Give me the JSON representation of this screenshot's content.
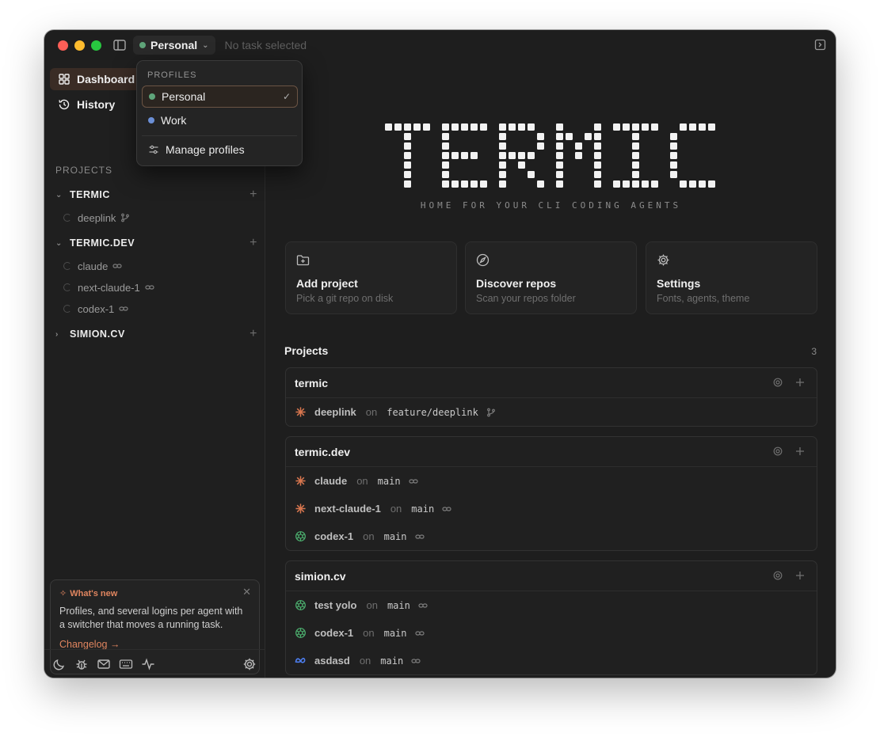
{
  "titlebar": {
    "profile_name": "Personal",
    "profile_color": "#5fa57a",
    "task_status": "No task selected"
  },
  "sidebar": {
    "nav": [
      {
        "label": "Dashboard",
        "icon": "grid-icon",
        "active": true
      },
      {
        "label": "History",
        "icon": "history-icon",
        "active": false
      }
    ],
    "projects_label": "PROJECTS",
    "projects": [
      {
        "name": "TERMIC",
        "expanded": true,
        "tasks": [
          {
            "name": "deeplink",
            "icon": "branch-icon"
          }
        ]
      },
      {
        "name": "TERMIC.DEV",
        "expanded": true,
        "tasks": [
          {
            "name": "claude",
            "icon": "link-icon"
          },
          {
            "name": "next-claude-1",
            "icon": "link-icon"
          },
          {
            "name": "codex-1",
            "icon": "link-icon"
          }
        ]
      },
      {
        "name": "SIMION.CV",
        "expanded": false,
        "tasks": []
      }
    ],
    "whats_new": {
      "title": "What's new",
      "body": "Profiles, and several logins per agent with a switcher that moves a running task.",
      "link": "Changelog →"
    }
  },
  "main": {
    "logo_text": "TERMIC",
    "tagline": "HOME FOR YOUR CLI CODING AGENTS",
    "cards": [
      {
        "title": "Add project",
        "subtitle": "Pick a git repo on disk",
        "icon": "folder-plus-icon"
      },
      {
        "title": "Discover repos",
        "subtitle": "Scan your repos folder",
        "icon": "compass-icon"
      },
      {
        "title": "Settings",
        "subtitle": "Fonts, agents, theme",
        "icon": "gear-icon"
      }
    ],
    "projects_heading": "Projects",
    "projects_count": "3",
    "project_cards": [
      {
        "name": "termic",
        "rows": [
          {
            "agent": "claude",
            "name": "deeplink",
            "on": "on",
            "branch": "feature/deeplink",
            "tail": "branch-icon"
          }
        ]
      },
      {
        "name": "termic.dev",
        "rows": [
          {
            "agent": "claude",
            "name": "claude",
            "on": "on",
            "branch": "main",
            "tail": "link-icon"
          },
          {
            "agent": "claude",
            "name": "next-claude-1",
            "on": "on",
            "branch": "main",
            "tail": "link-icon"
          },
          {
            "agent": "codex",
            "name": "codex-1",
            "on": "on",
            "branch": "main",
            "tail": "link-icon"
          }
        ]
      },
      {
        "name": "simion.cv",
        "rows": [
          {
            "agent": "codex",
            "name": "test yolo",
            "on": "on",
            "branch": "main",
            "tail": "link-icon"
          },
          {
            "agent": "codex",
            "name": "codex-1",
            "on": "on",
            "branch": "main",
            "tail": "link-icon"
          },
          {
            "agent": "meta",
            "name": "asdasd",
            "on": "on",
            "branch": "main",
            "tail": "link-icon"
          }
        ]
      }
    ]
  },
  "profiles_menu": {
    "label": "PROFILES",
    "items": [
      {
        "name": "Personal",
        "color": "#5fa57a",
        "selected": true
      },
      {
        "name": "Work",
        "color": "#6b8fd6",
        "selected": false
      }
    ],
    "manage_label": "Manage profiles"
  },
  "colors": {
    "accent": "#e0855f",
    "claude": "#d9774f",
    "codex": "#4caf6e",
    "meta": "#4d7ef0"
  }
}
